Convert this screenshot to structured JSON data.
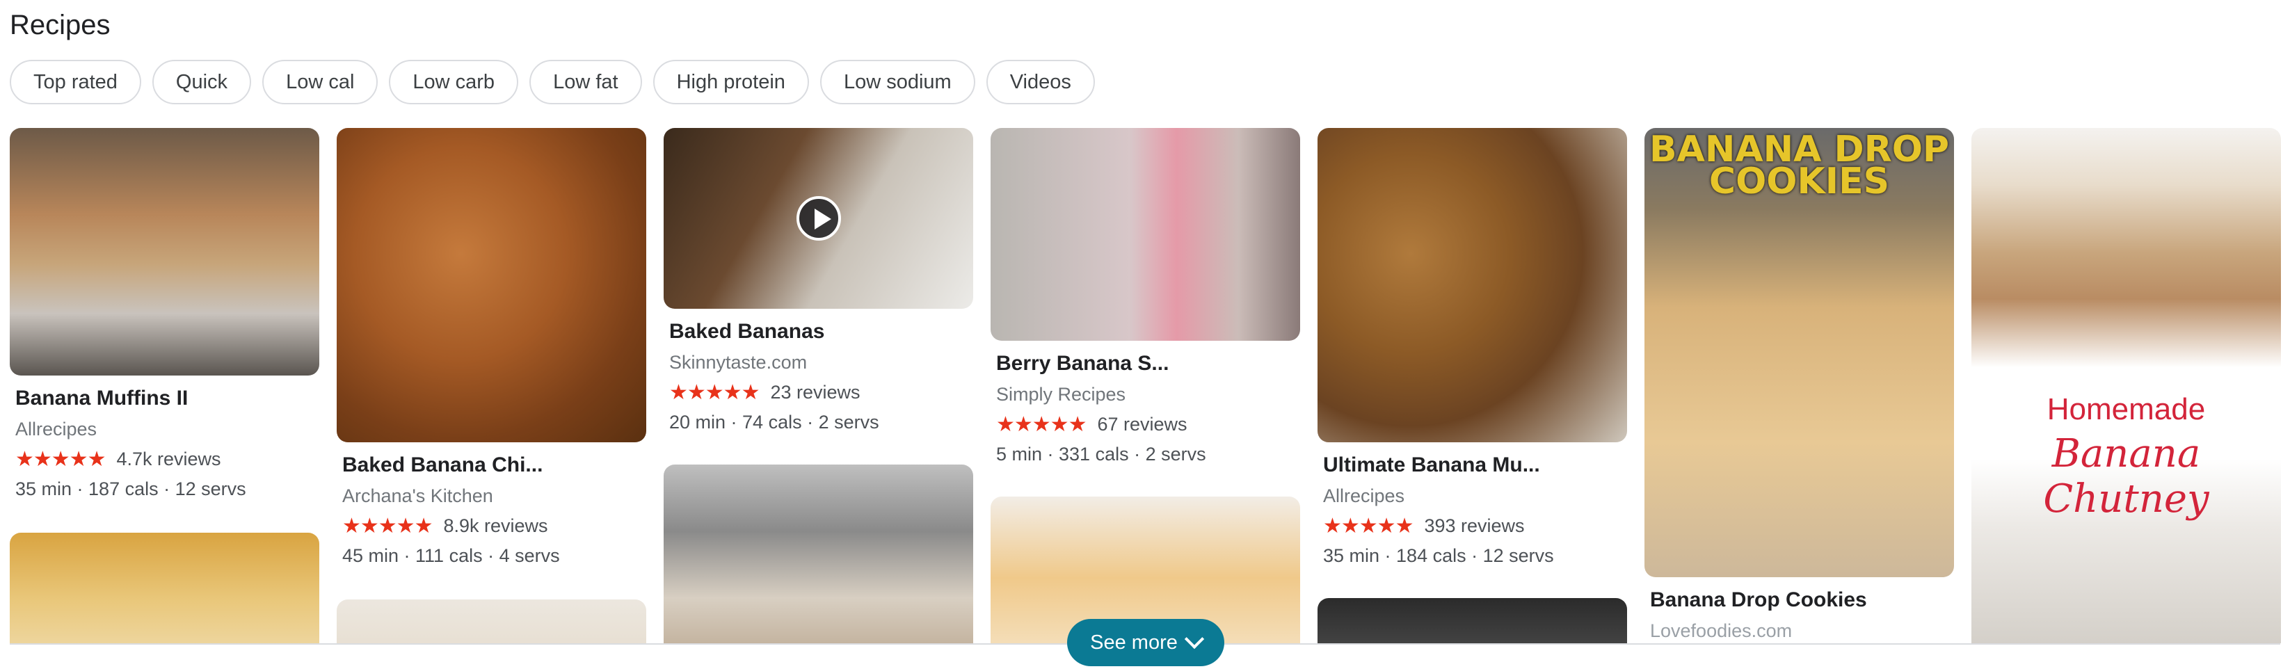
{
  "section": {
    "title": "Recipes"
  },
  "chips": [
    "Top rated",
    "Quick",
    "Low cal",
    "Low carb",
    "Low fat",
    "High protein",
    "Low sodium",
    "Videos"
  ],
  "cards": [
    {
      "name": "Banana Muffins II",
      "source": "Allrecipes",
      "stars": "★★★★★",
      "reviews": "4.7k reviews",
      "meta": "35 min · 187 cals · 12 servs"
    },
    {
      "name": "Baked Banana Chi...",
      "source": "Archana's Kitchen",
      "stars": "★★★★★",
      "reviews": "8.9k reviews",
      "meta": "45 min · 111 cals · 4 servs"
    },
    {
      "name": "Baked Bananas",
      "source": "Skinnytaste.com",
      "stars": "★★★★★",
      "reviews": "23 reviews",
      "meta": "20 min · 74 cals · 2 servs",
      "has_video": true
    },
    {
      "name": "Berry Banana S...",
      "source": "Simply Recipes",
      "stars": "★★★★★",
      "reviews": "67 reviews",
      "meta": "5 min · 331 cals · 2 servs"
    },
    {
      "name": "Ultimate Banana Mu...",
      "source": "Allrecipes",
      "stars": "★★★★★",
      "reviews": "393 reviews",
      "meta": "35 min · 184 cals · 12 servs"
    },
    {
      "name": "Banana Drop Cookies",
      "source": "Lovefoodies.com",
      "image_text": "BANANA DROP COOKIES"
    },
    {
      "image_text_line1": "Homemade",
      "image_text_line2": "Banana Chutney"
    }
  ],
  "see_more": {
    "label": "See more"
  },
  "icons": {
    "play": "play-icon",
    "chevron": "chevron-down-icon"
  },
  "colors": {
    "star": "#e8321a",
    "see_more_bg": "#0b7a94"
  }
}
